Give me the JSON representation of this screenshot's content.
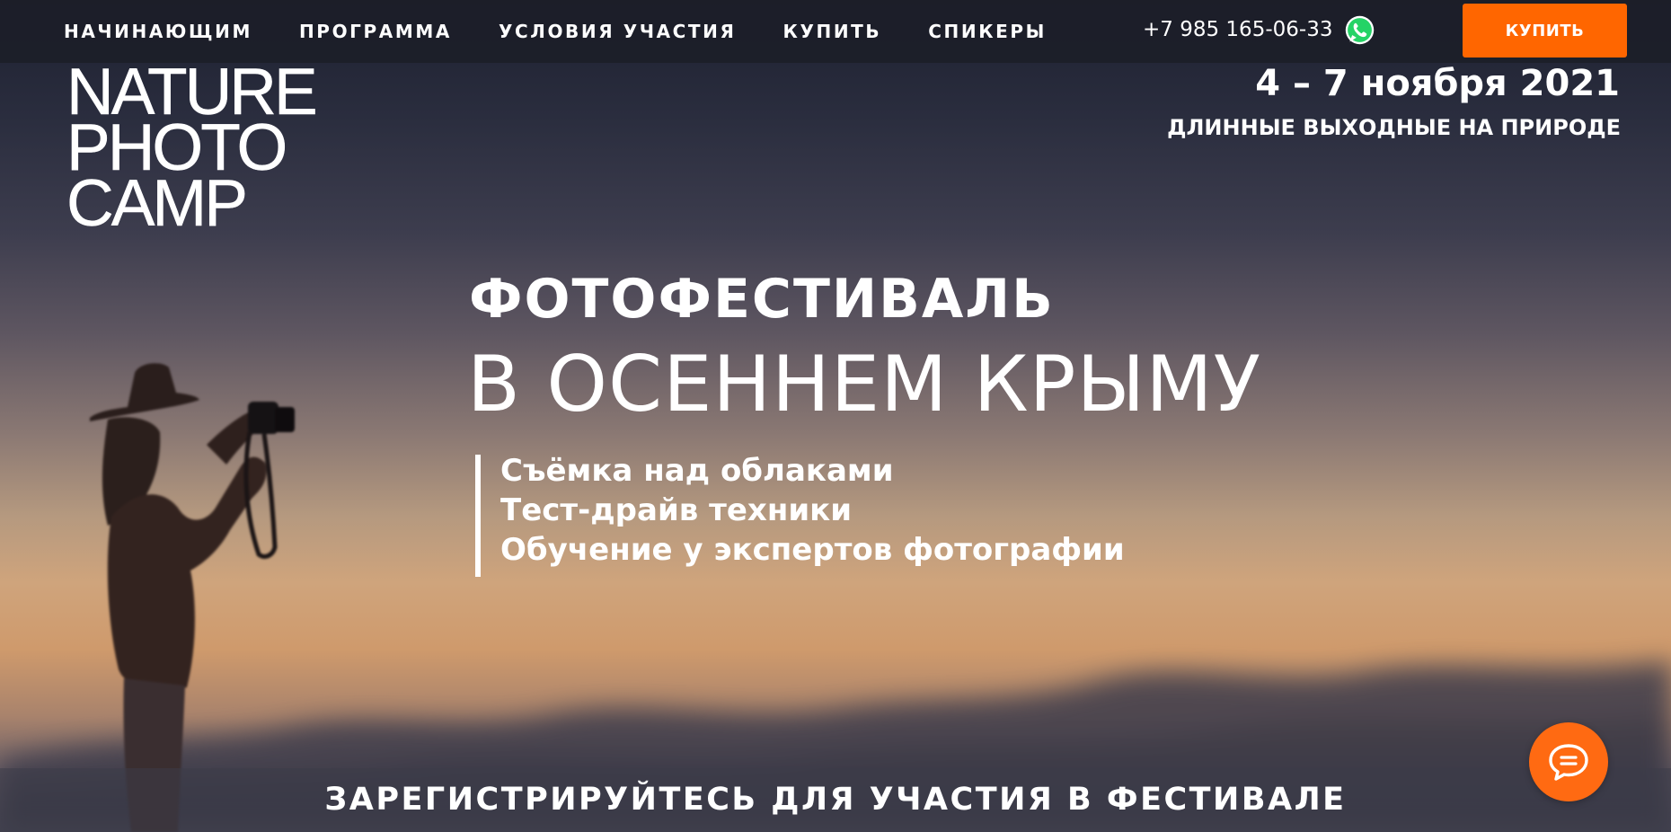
{
  "nav": {
    "items": [
      {
        "label": "НАЧИНАЮЩИМ"
      },
      {
        "label": "ПРОГРАММА"
      },
      {
        "label": "УСЛОВИЯ УЧАСТИЯ"
      },
      {
        "label": "КУПИТЬ"
      },
      {
        "label": "СПИКЕРЫ"
      }
    ],
    "phone": "+7 985 165-06-33",
    "buy_label": "КУПИТЬ"
  },
  "logo": {
    "line1": "NATURE",
    "line2": "PHOTO",
    "line3": "CAMP"
  },
  "event": {
    "dates": "4 – 7 ноября 2021",
    "subtitle": "ДЛИННЫЕ ВЫХОДНЫЕ НА ПРИРОДЕ"
  },
  "hero": {
    "line1": "ФОТОФЕСТИВАЛЬ",
    "line2": "В ОСЕННЕМ КРЫМУ",
    "features": [
      "Съёмка над облаками",
      "Тест-драйв техники",
      "Обучение у экспертов фотографии"
    ]
  },
  "register": {
    "label": "ЗАРЕГИСТРИРУЙТЕСЬ ДЛЯ УЧАСТИЯ В ФЕСТИВАЛЕ"
  },
  "colors": {
    "accent": "#ff6600",
    "topbar": "#1c1e28",
    "text": "#ffffff"
  },
  "icons": {
    "whatsapp": "whatsapp-icon",
    "chat": "chat-bubble-icon"
  }
}
